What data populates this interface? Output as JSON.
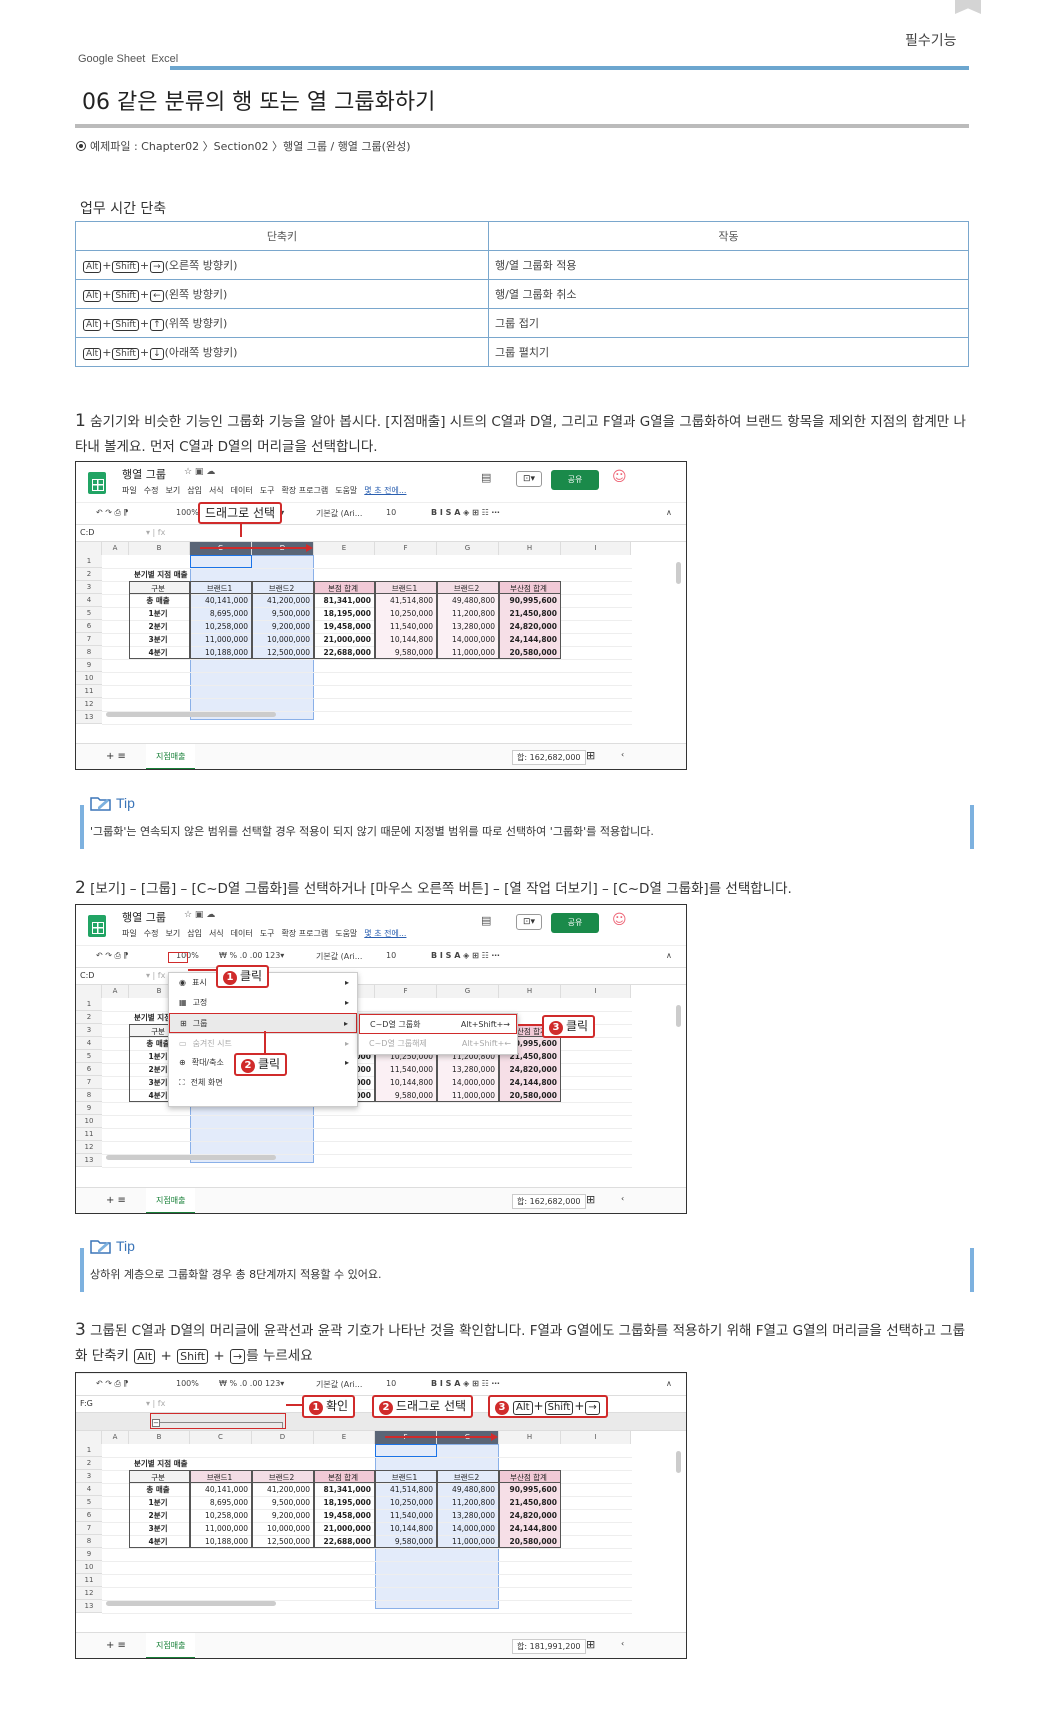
{
  "header": {
    "section_label": "필수기능",
    "apps": [
      "Google Sheet",
      "Excel"
    ],
    "title": "06 같은 분류의 행 또는 열 그룹화하기",
    "example": "예제파일 : Chapter02 〉Section02 〉행열 그룹 / 행열 그룹(완성)"
  },
  "shortcuts": {
    "title": "업무 시간 단축",
    "col_shortcut": "단축키",
    "col_action": "작동",
    "rows": [
      {
        "keys": [
          "Alt",
          "Shift"
        ],
        "arrow": "→",
        "desc": "(오른쪽 방향키)",
        "action": "행/열 그룹화 적용"
      },
      {
        "keys": [
          "Alt",
          "Shift"
        ],
        "arrow": "←",
        "desc": "(왼쪽 방향키)",
        "action": "행/열 그룹화 취소"
      },
      {
        "keys": [
          "Alt",
          "Shift"
        ],
        "arrow": "↑",
        "desc": "(위쪽 방향키)",
        "action": "그룹 접기"
      },
      {
        "keys": [
          "Alt",
          "Shift"
        ],
        "arrow": "↓",
        "desc": "(아래쪽 방향키)",
        "action": "그룹 펼치기"
      }
    ]
  },
  "step1": {
    "num": "1",
    "text": "숨기기와 비슷한 기능인 그룹화 기능을 알아 봅시다. [지점매출] 시트의 C열과 D열, 그리고 F열과 G열을 그룹화하여 브랜드 항목을 제외한 지점의 합계만 나타내 볼게요. 먼저 C열과 D열의 머리글을 선택합니다."
  },
  "tip1": {
    "label": "Tip",
    "text": "'그룹화'는 연속되지 않은 범위를 선택할 경우 적용이 되지 않기 때문에 지정별 범위를 따로 선택하여 '그룹화'를 적용합니다."
  },
  "step2": {
    "num": "2",
    "text": "[보기] – [그룹] – [C~D열 그룹화]를 선택하거나 [마우스 오른쪽 버튼] – [열 작업 더보기] – [C~D열 그룹화]를 선택합니다."
  },
  "tip2": {
    "label": "Tip",
    "text": "상하위 계층으로 그룹화할 경우 총 8단계까지 적용할 수 있어요."
  },
  "step3": {
    "num": "3",
    "text_a": "그룹된 C열과 D열의 머리글에 윤곽선과 윤곽 기호가 나타난 것을 확인합니다. F열과 G열에도 그룹화를 적용하기 위해 F열고 G열의 머리글을 선택하고 그룹화 단축키",
    "key_alt": "Alt",
    "key_shift": "Shift",
    "arrow": "→",
    "text_b": "를 누르세요"
  },
  "sheet": {
    "doc_name": "행열 그룹",
    "menus": [
      "파일",
      "수정",
      "보기",
      "삽입",
      "서식",
      "데이터",
      "도구",
      "확장 프로그램",
      "도움말"
    ],
    "last_edit": "몇 초 전에...",
    "share": "공유",
    "zoom": "100%",
    "font": "기본값 (Ari...",
    "font_size": "10",
    "cols": [
      "A",
      "B",
      "C",
      "D",
      "E",
      "F",
      "G",
      "H",
      "I"
    ],
    "rows": [
      "1",
      "2",
      "3",
      "4",
      "5",
      "6",
      "7",
      "8",
      "9",
      "10",
      "11",
      "12",
      "13"
    ],
    "table_title": "분기별 지점 매출",
    "headers": [
      "구분",
      "브랜드1",
      "브랜드2",
      "본점 합계",
      "브랜드1",
      "브랜드2",
      "부산점 합계"
    ],
    "data": [
      [
        "총 매출",
        "40,141,000",
        "41,200,000",
        "81,341,000",
        "41,514,800",
        "49,480,800",
        "90,995,600"
      ],
      [
        "1분기",
        "8,695,000",
        "9,500,000",
        "18,195,000",
        "10,250,000",
        "11,200,800",
        "21,450,800"
      ],
      [
        "2분기",
        "10,258,000",
        "9,200,000",
        "19,458,000",
        "11,540,000",
        "13,280,000",
        "24,820,000"
      ],
      [
        "3분기",
        "11,000,000",
        "10,000,000",
        "21,000,000",
        "10,144,800",
        "14,000,000",
        "24,144,800"
      ],
      [
        "4분기",
        "10,188,000",
        "12,500,000",
        "22,688,000",
        "9,580,000",
        "11,000,000",
        "20,580,000"
      ]
    ],
    "sheet_tab": "지점매출",
    "sum1": "합: 162,682,000",
    "sum3": "합: 181,991,200"
  },
  "ss1": {
    "namebox": "C:D",
    "callout": "드래그로 선택"
  },
  "ss2": {
    "namebox": "C:D",
    "menu_items": [
      "표시",
      "고정",
      "그룹",
      "숨겨진 시트",
      "확대/축소",
      "전체 화면"
    ],
    "sub_items": [
      {
        "label": "C~D열 그룹화",
        "key": "Alt+Shift+→"
      },
      {
        "label": "C~D열 그룹해제",
        "key": "Alt+Shift+←"
      }
    ],
    "callout1": "클릭",
    "callout2": "클릭",
    "callout3": "클릭",
    "partial_col": "합계"
  },
  "ss3": {
    "namebox": "F:G",
    "callout1": "확인",
    "callout2": "드래그로 선택",
    "callout3_keys": [
      "Alt",
      "Shift"
    ],
    "callout3_arrow": "→"
  },
  "colors": {
    "accent_blue": "#6ca6cf",
    "callout_red": "#d02b2b",
    "sheets_green": "#21a464",
    "selection": "#e3ebfa",
    "pink": "#f3dde5"
  }
}
